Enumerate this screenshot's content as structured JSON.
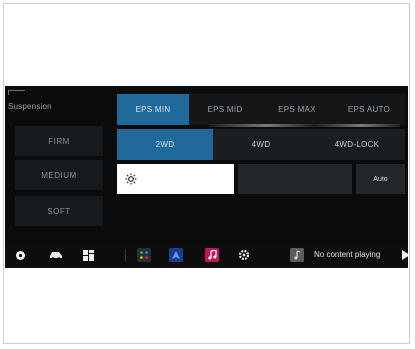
{
  "suspension": {
    "title": "Suspension",
    "options": [
      "FIRM",
      "MEDIUM",
      "SOFT"
    ]
  },
  "eps": {
    "options": [
      "EPS MIN",
      "EPS MID",
      "EPS MAX",
      "EPS AUTO"
    ],
    "selected": "EPS MIN"
  },
  "drive": {
    "options": [
      "2WD",
      "4WD",
      "4WD-LOCK"
    ],
    "selected": "2WD"
  },
  "brightness": {
    "auto_label": "Auto"
  },
  "taskbar": {
    "now_playing": "No content playing"
  },
  "colors": {
    "accent": "#1f6a9a",
    "background": "#0b0b0b"
  },
  "icons": [
    "home-icon",
    "car-icon",
    "apps-grid-icon",
    "app-launcher-icon",
    "navigation-icon",
    "music-icon",
    "settings-icon",
    "music-note-icon",
    "play-icon",
    "sun-icon"
  ]
}
